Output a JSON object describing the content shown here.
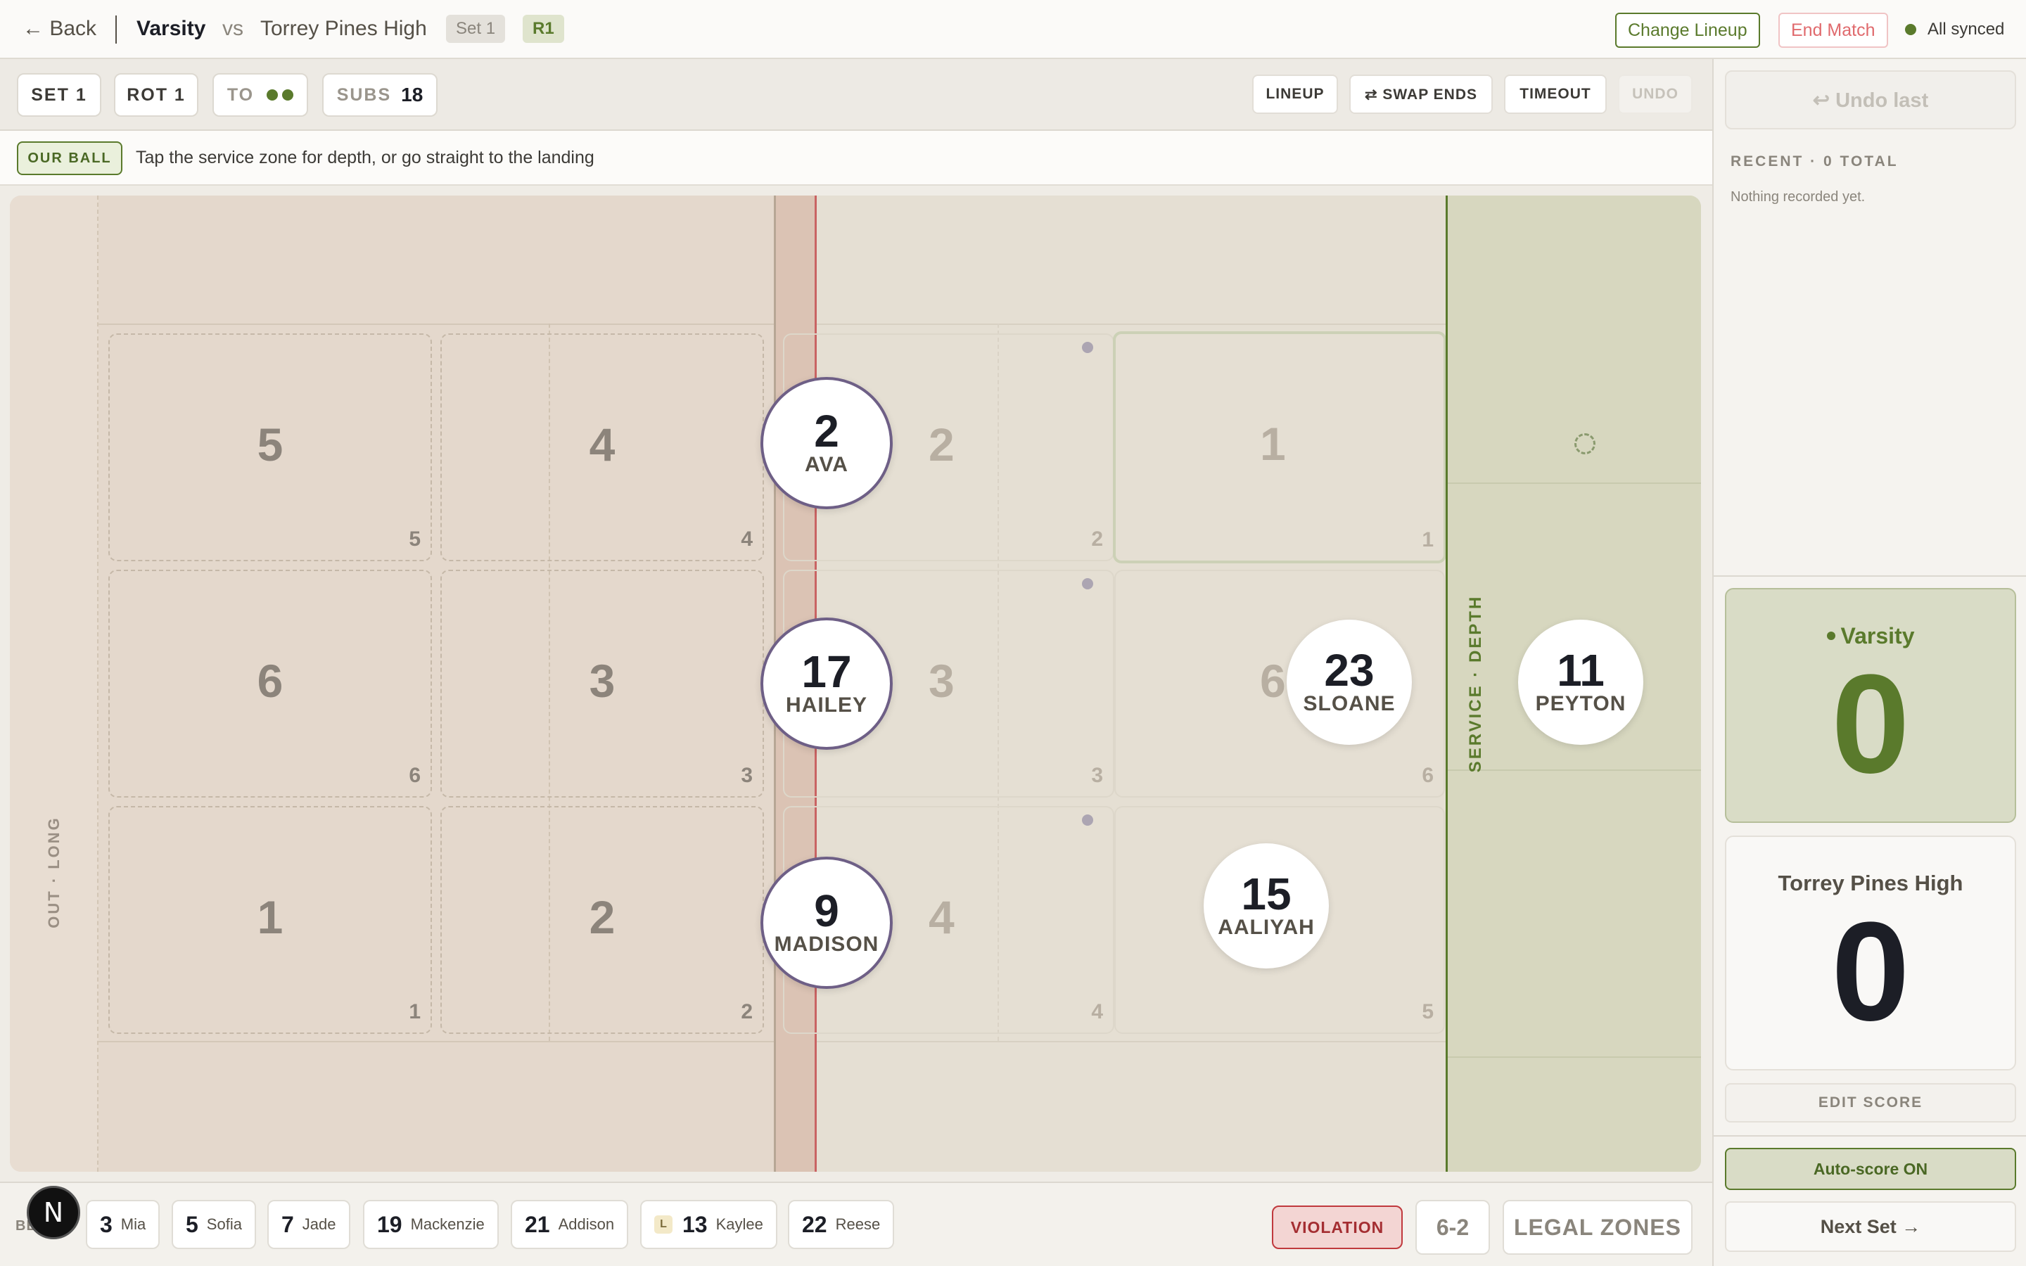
{
  "topbar": {
    "back_label": "← Back",
    "home_team": "Varsity",
    "vs": "vs",
    "away_team": "Torrey Pines High",
    "set_pill": "Set 1",
    "rot_pill": "R1",
    "change_lineup": "Change Lineup",
    "end_match": "End Match",
    "sync_status": "All synced"
  },
  "toolbar": {
    "set": "SET 1",
    "rot": "ROT 1",
    "timeouts_label": "TO",
    "subs_label": "SUBS",
    "subs_value": "18",
    "lineup": "LINEUP",
    "swap_ends": "⇄ SWAP ENDS",
    "timeout": "TIMEOUT",
    "undo": "UNDO"
  },
  "hint": {
    "badge": "OUR BALL",
    "text": "Tap the service zone for depth, or go straight to the landing"
  },
  "court": {
    "out_label": "OUT · LONG",
    "service_label": "SERVICE · DEPTH",
    "target_zones": [
      {
        "big": "5",
        "small": "5"
      },
      {
        "big": "4",
        "small": "4"
      },
      {
        "big": "6",
        "small": "6"
      },
      {
        "big": "3",
        "small": "3"
      },
      {
        "big": "1",
        "small": "1"
      },
      {
        "big": "2",
        "small": "2"
      }
    ],
    "own_zones": [
      {
        "big": "2",
        "small": "2"
      },
      {
        "big": "1",
        "small": "1"
      },
      {
        "big": "3",
        "small": "3"
      },
      {
        "big": "6",
        "small": "6"
      },
      {
        "big": "4",
        "small": "4"
      },
      {
        "big": "5",
        "small": "5"
      }
    ],
    "players": {
      "ava": {
        "number": "2",
        "name": "AVA"
      },
      "hailey": {
        "number": "17",
        "name": "HAILEY"
      },
      "madison": {
        "number": "9",
        "name": "MADISON"
      },
      "sloane": {
        "number": "23",
        "name": "SLOANE"
      },
      "peyton": {
        "number": "11",
        "name": "PEYTON"
      },
      "aaliyah": {
        "number": "15",
        "name": "AALIYAH"
      }
    }
  },
  "bench": {
    "label": "BE",
    "players": [
      {
        "number": "3",
        "name": "Mia"
      },
      {
        "number": "5",
        "name": "Sofia"
      },
      {
        "number": "7",
        "name": "Jade"
      },
      {
        "number": "19",
        "name": "Mackenzie"
      },
      {
        "number": "21",
        "name": "Addison"
      },
      {
        "number": "13",
        "name": "Kaylee",
        "libero": "L"
      },
      {
        "number": "22",
        "name": "Reese"
      }
    ]
  },
  "bottom_actions": {
    "violation": "VIOLATION",
    "system": "6-2",
    "legal_zones": "LEGAL ZONES"
  },
  "fab": {
    "letter": "N"
  },
  "right_panel": {
    "undo_last": "↩ Undo last",
    "recent_label": "RECENT · 0 TOTAL",
    "empty_text": "Nothing recorded yet.",
    "home": {
      "name": "Varsity",
      "score": "0"
    },
    "away": {
      "name": "Torrey Pines High",
      "score": "0"
    },
    "edit_score": "EDIT SCORE",
    "auto_score": "Auto-score ON",
    "next_set": "Next Set →"
  },
  "colors": {
    "accent_green": "#5a7a2c",
    "danger_red": "#c0393d",
    "player_ring": "#6e5f86",
    "net": "#c96363"
  }
}
